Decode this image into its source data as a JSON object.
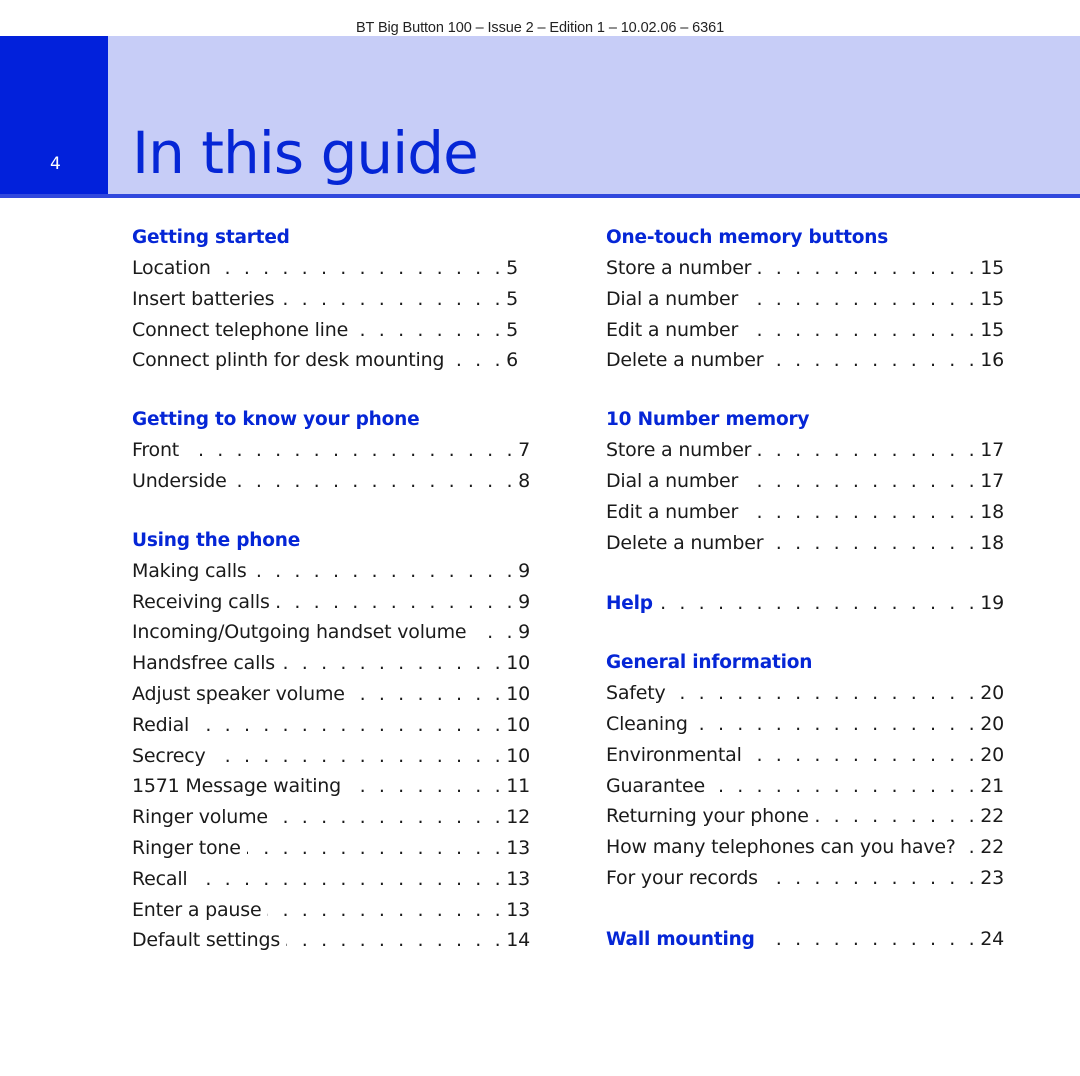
{
  "document_header": "BT Big Button 100 – Issue 2 – Edition 1 – 10.02.06 – 6361",
  "page_number": "4",
  "page_title": "In this guide",
  "colors": {
    "brand_blue": "#0221db",
    "heading_blue": "#0526d6",
    "band_lavender": "#c7cdf7",
    "rule_blue": "#3148dd"
  },
  "left_column": [
    {
      "heading": "Getting started",
      "entries": [
        {
          "label": "Location",
          "page": "5"
        },
        {
          "label": "Insert batteries",
          "page": "5"
        },
        {
          "label": "Connect telephone line",
          "page": "5"
        },
        {
          "label": "Connect plinth for desk mounting",
          "page": "6"
        }
      ]
    },
    {
      "heading": "Getting to know your phone",
      "entries": [
        {
          "label": "Front",
          "page": "7"
        },
        {
          "label": "Underside",
          "page": "8"
        }
      ]
    },
    {
      "heading": "Using the phone",
      "entries": [
        {
          "label": "Making calls",
          "page": "9"
        },
        {
          "label": "Receiving calls",
          "page": "9"
        },
        {
          "label": "Incoming/Outgoing handset volume",
          "page": "9"
        },
        {
          "label": "Handsfree calls",
          "page": "10"
        },
        {
          "label": "Adjust speaker volume",
          "page": "10"
        },
        {
          "label": "Redial",
          "page": "10"
        },
        {
          "label": "Secrecy",
          "page": "10"
        },
        {
          "label": "1571 Message waiting",
          "page": "11"
        },
        {
          "label": "Ringer volume",
          "page": "12"
        },
        {
          "label": "Ringer tone",
          "page": "13"
        },
        {
          "label": "Recall",
          "page": "13"
        },
        {
          "label": "Enter a pause",
          "page": "13"
        },
        {
          "label": "Default settings",
          "page": "14"
        }
      ]
    }
  ],
  "right_column": [
    {
      "heading": "One-touch memory buttons",
      "entries": [
        {
          "label": "Store a number",
          "page": "15"
        },
        {
          "label": "Dial a number",
          "page": "15"
        },
        {
          "label": "Edit a number",
          "page": "15"
        },
        {
          "label": "Delete a number",
          "page": "16"
        }
      ]
    },
    {
      "heading": "10 Number memory",
      "entries": [
        {
          "label": "Store a number",
          "page": "17"
        },
        {
          "label": "Dial a number",
          "page": "17"
        },
        {
          "label": "Edit a number",
          "page": "18"
        },
        {
          "label": "Delete a number",
          "page": "18"
        }
      ]
    },
    {
      "heading_entry": {
        "label": "Help",
        "page": "19"
      }
    },
    {
      "heading": "General information",
      "entries": [
        {
          "label": "Safety",
          "page": "20"
        },
        {
          "label": "Cleaning",
          "page": "20"
        },
        {
          "label": "Environmental",
          "page": "20"
        },
        {
          "label": "Guarantee",
          "page": "21"
        },
        {
          "label": "Returning your phone",
          "page": "22"
        },
        {
          "label": "How many telephones can you have?",
          "page": "22"
        },
        {
          "label": "For your records",
          "page": "23"
        }
      ]
    },
    {
      "heading_entry": {
        "label": "Wall mounting",
        "page": "24"
      }
    }
  ],
  "leader_char": ". "
}
